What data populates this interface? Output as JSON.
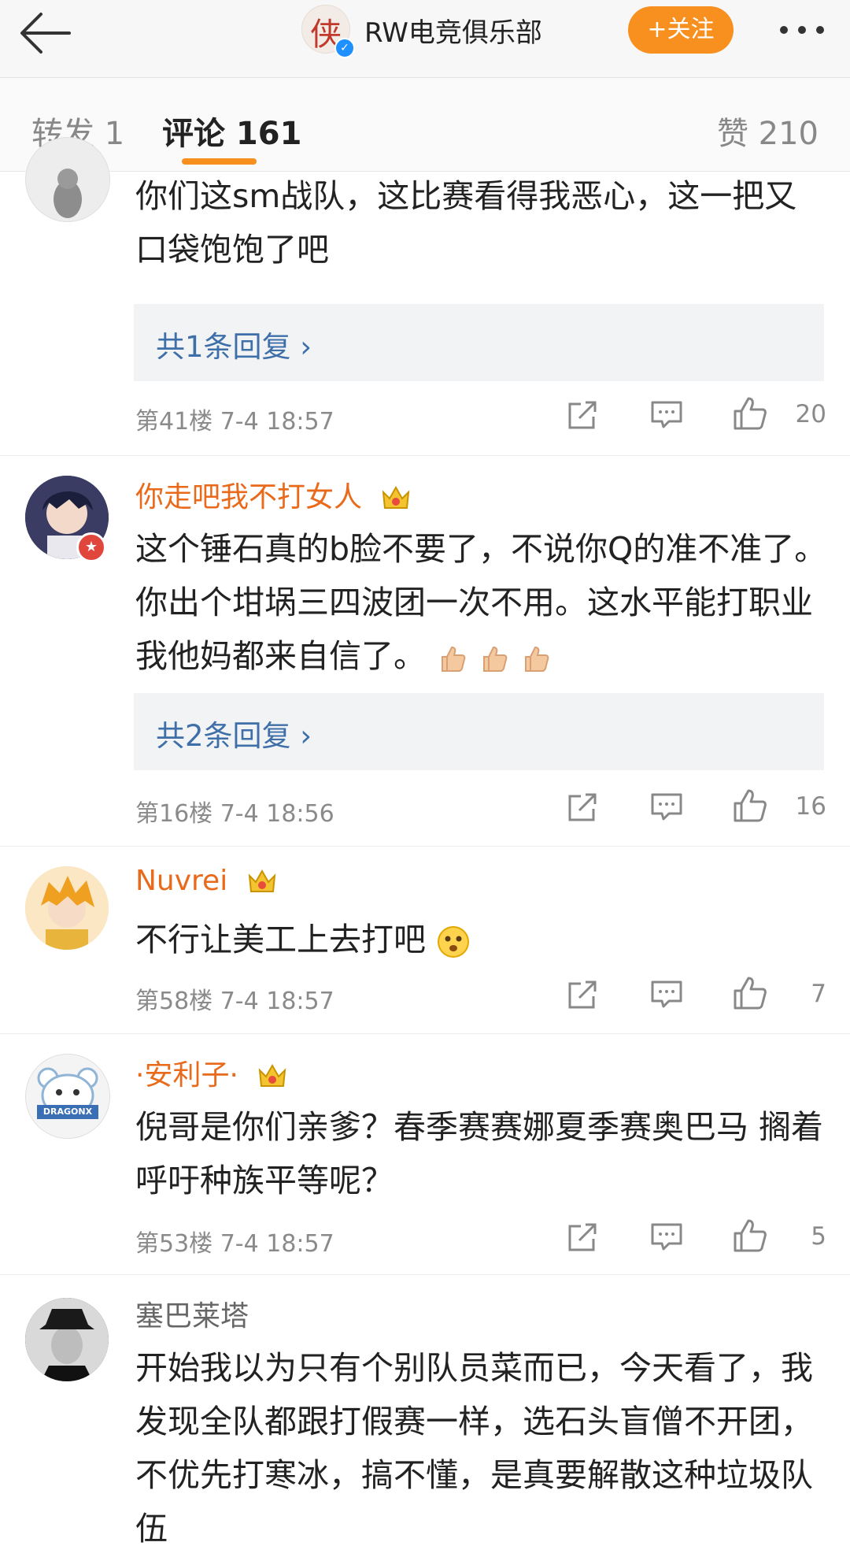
{
  "header": {
    "account_avatar_glyph": "侠",
    "account_name": "RW电竞俱乐部",
    "follow_label": "+关注"
  },
  "tabs": {
    "repost": "转发 1",
    "comments": "评论 161",
    "likes": "赞 210"
  },
  "comments": [
    {
      "username": "",
      "text": "你们这sm战队，这比赛看得我恶心，这一把又口袋饱饱了吧",
      "replies": "共1条回复",
      "meta": "第41楼  7-4 18:57",
      "likes": "20"
    },
    {
      "username": "你走吧我不打女人",
      "text": "这个锤石真的b脸不要了，不说你Q的准不准了。你出个坩埚三四波团一次不用。这水平能打职业我他妈都来自信了。",
      "replies": "共2条回复",
      "meta": "第16楼  7-4 18:56",
      "likes": "16"
    },
    {
      "username": "Nuvrei",
      "text": "不行让美工上去打吧",
      "meta": "第58楼  7-4 18:57",
      "likes": "7"
    },
    {
      "username": "·安利子·",
      "text": "倪哥是你们亲爹？春季赛赛娜夏季赛奥巴马 搁着呼吁种族平等呢？",
      "avatar_text": "DRAGONX",
      "meta": "第53楼  7-4 18:57",
      "likes": "5"
    },
    {
      "username": "塞巴莱塔",
      "text": "开始我以为只有个别队员菜而已，今天看了，我发现全队都跟打假赛一样，选石头盲僧不开团，不优先打寒冰，搞不懂，是真要解散这种垃圾队伍"
    }
  ],
  "icons": {
    "back": "back-arrow-icon",
    "more": "more-icon",
    "share": "share-icon",
    "comment": "comment-icon",
    "like": "like-icon",
    "crown": "vip-crown-icon",
    "thumbs_up": "thumbs-up-emoji",
    "worried": "worried-emoji"
  },
  "colors": {
    "accent": "#f7901e",
    "username": "#e86a1a",
    "link": "#3e6fa8"
  }
}
